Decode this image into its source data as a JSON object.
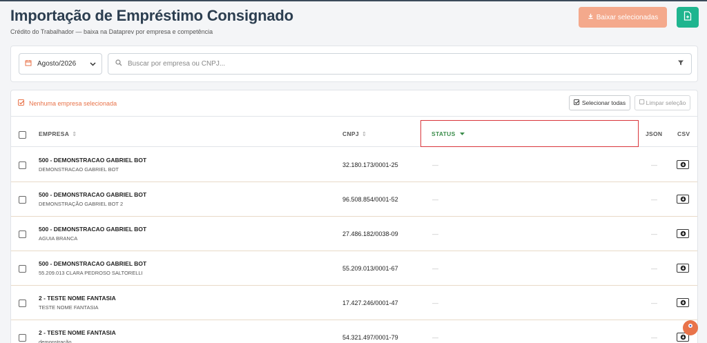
{
  "header": {
    "title": "Importação de Empréstimo Consignado",
    "subtitle": "Crédito do Trabalhador — baixa na Dataprev por empresa e competência",
    "download_label": "Baixar selecionadas"
  },
  "filters": {
    "month": "Agosto/2026",
    "search_placeholder": "Buscar por empresa ou CNPJ..."
  },
  "selection": {
    "status_text": "Nenhuma empresa selecionada",
    "select_all_label": "Selecionar todas",
    "clear_label": "Limpar seleção"
  },
  "table": {
    "columns": {
      "empresa": "EMPRESA",
      "cnpj": "CNPJ",
      "status": "STATUS",
      "json": "JSON",
      "csv": "CSV"
    },
    "rows": [
      {
        "name": "500 - DEMONSTRACAO GABRIEL BOT",
        "sub": "DEMONSTRACAO GABRIEL BOT",
        "cnpj": "32.180.173/0001-25",
        "status": "—",
        "json": "—"
      },
      {
        "name": "500 - DEMONSTRACAO GABRIEL BOT",
        "sub": "DEMONSTRAÇÃO GABRIEL BOT 2",
        "cnpj": "96.508.854/0001-52",
        "status": "—",
        "json": "—"
      },
      {
        "name": "500 - DEMONSTRACAO GABRIEL BOT",
        "sub": "AGUIA BRANCA",
        "cnpj": "27.486.182/0038-09",
        "status": "—",
        "json": "—"
      },
      {
        "name": "500 - DEMONSTRACAO GABRIEL BOT",
        "sub": "55.209.013 CLARA PEDROSO SALTORELLI",
        "cnpj": "55.209.013/0001-67",
        "status": "—",
        "json": "—"
      },
      {
        "name": "2 - TESTE NOME FANTASIA",
        "sub": "TESTE NOME FANTASIA",
        "cnpj": "17.427.246/0001-47",
        "status": "—",
        "json": "—"
      },
      {
        "name": "2 - TESTE NOME FANTASIA",
        "sub": "demonstração",
        "cnpj": "54.321.497/0001-79",
        "status": "—",
        "json": "—"
      }
    ]
  },
  "colors": {
    "accent": "#e8734a",
    "export_green": "#1fb58f",
    "status_header": "#3a8c4a",
    "highlight_box": "#d9343a"
  }
}
